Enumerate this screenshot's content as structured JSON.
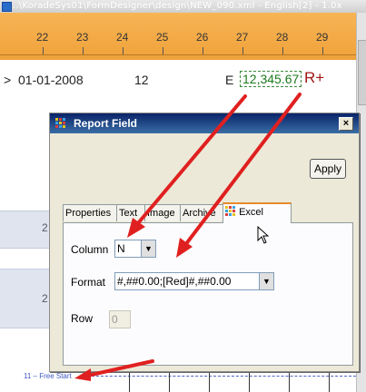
{
  "window": {
    "path": "..\\KoradeSys01\\FormDesigner\\design\\NEW_090.xml - English[2] - 1.0x"
  },
  "ruler": {
    "numbers": [
      "22",
      "23",
      "24",
      "25",
      "26",
      "27",
      "28",
      "29"
    ]
  },
  "datarow": {
    "arrow": ">",
    "date": "01-01-2008",
    "qty": "12",
    "code": "E",
    "amount": "12,345.67",
    "rplus": "R+"
  },
  "bands": [
    "2",
    "2"
  ],
  "footer": {
    "section_label": "11 – Free Start"
  },
  "dialog": {
    "title": "Report Field",
    "close_label": "×",
    "apply_label": "Apply",
    "tabs": [
      "Properties",
      "Text",
      "Image",
      "Archive",
      "Excel"
    ],
    "active_tab": "Excel",
    "column_label": "Column",
    "column_value": "N",
    "format_label": "Format",
    "format_value": "#,##0.00;[Red]#,##0.00",
    "row_label": "Row",
    "row_value": "0"
  },
  "colors": {
    "ruler": "#f0a23a",
    "title_bar": "#0a246a",
    "arrow": "#e02020",
    "amount": "#1b7a1b",
    "rplus": "#a01818"
  }
}
